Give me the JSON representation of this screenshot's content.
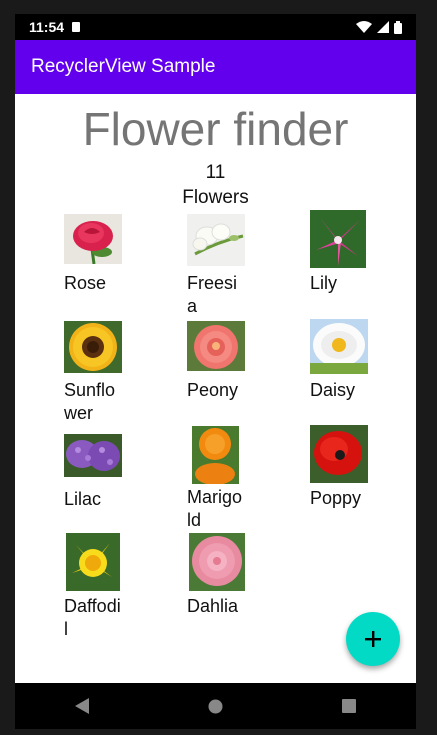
{
  "status_bar": {
    "time": "11:54"
  },
  "app_bar": {
    "title": "RecyclerView Sample"
  },
  "header": {
    "title": "Flower finder",
    "count_number": "11",
    "count_label": "Flowers"
  },
  "flowers": [
    {
      "name": "Rose",
      "icon": "rose-image"
    },
    {
      "name": "Freesia",
      "icon": "freesia-image"
    },
    {
      "name": "Lily",
      "icon": "lily-image"
    },
    {
      "name": "Sunflower",
      "icon": "sunflower-image"
    },
    {
      "name": "Peony",
      "icon": "peony-image"
    },
    {
      "name": "Daisy",
      "icon": "daisy-image"
    },
    {
      "name": "Lilac",
      "icon": "lilac-image"
    },
    {
      "name": "Marigold",
      "icon": "marigold-image"
    },
    {
      "name": "Poppy",
      "icon": "poppy-image"
    },
    {
      "name": "Daffodil",
      "icon": "daffodil-image"
    },
    {
      "name": "Dahlia",
      "icon": "dahlia-image"
    }
  ],
  "fab": {
    "icon": "plus-icon"
  },
  "colors": {
    "primary": "#6200EE",
    "accent": "#03DAC5"
  }
}
